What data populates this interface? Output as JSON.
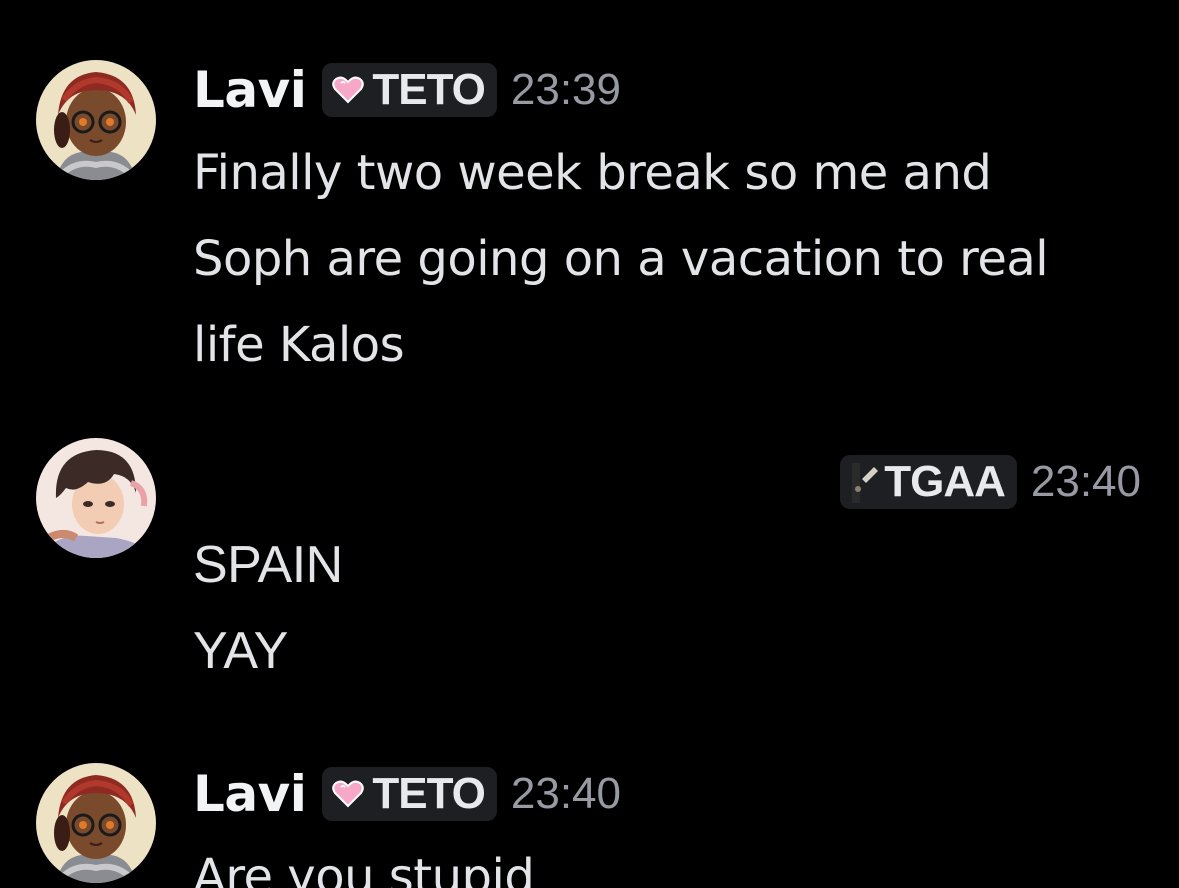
{
  "messages": [
    {
      "username": "Lavi",
      "tag": "TETO",
      "timestamp": "23:39",
      "lines": [
        "Finally two week break so me and",
        "Soph are going on a vacation to real",
        "life Kalos"
      ]
    },
    {
      "username": "",
      "tag": "TGAA",
      "timestamp": "23:40",
      "lines": [
        "SPAIN",
        "YAY"
      ]
    },
    {
      "username": "Lavi",
      "tag": "TETO",
      "timestamp": "23:40",
      "lines": [
        "Are you stupid"
      ]
    }
  ],
  "icons": {
    "teto_tag": "pink-heart-icon",
    "tgaa_tag": "server-tag-icon"
  },
  "colors": {
    "background": "#000000",
    "text": "#e3e4e8",
    "timestamp": "#979aa3",
    "tag_background": "#1e1f22",
    "heart": "#f7a8c8"
  }
}
